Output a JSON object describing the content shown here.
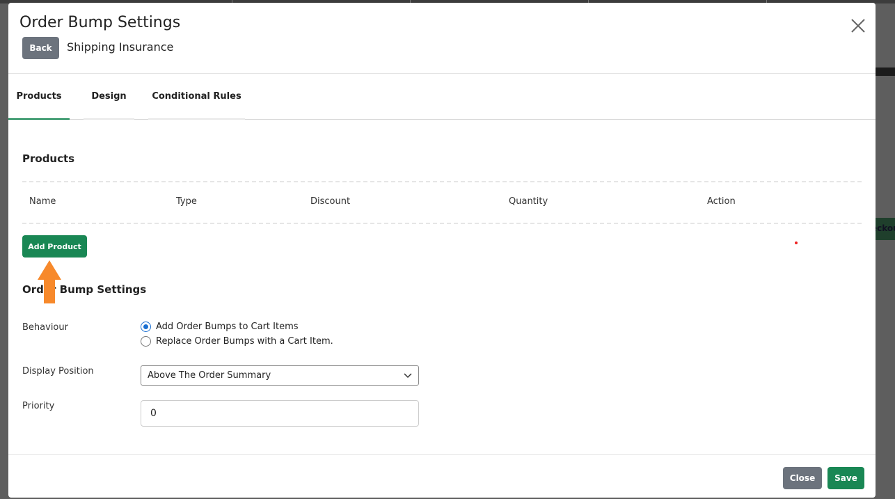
{
  "modal": {
    "title": "Order Bump Settings",
    "back_label": "Back",
    "bump_name": "Shipping Insurance"
  },
  "tabs": [
    {
      "label": "Products",
      "active": true
    },
    {
      "label": "Design",
      "active": false
    },
    {
      "label": "Conditional Rules",
      "active": false
    }
  ],
  "products": {
    "title": "Products",
    "columns": [
      "Name",
      "Type",
      "Discount",
      "Quantity",
      "Action"
    ],
    "rows": [],
    "add_label": "Add Product"
  },
  "settings": {
    "title": "Order Bump Settings",
    "behaviour_label": "Behaviour",
    "behaviour_options": [
      {
        "label": "Add Order Bumps to Cart Items",
        "checked": true
      },
      {
        "label": "Replace Order Bumps with a Cart Item.",
        "checked": false
      }
    ],
    "position_label": "Display Position",
    "position_value": "Above The Order Summary",
    "priority_label": "Priority",
    "priority_value": "0"
  },
  "footer": {
    "close_label": "Close",
    "save_label": "Save"
  },
  "backdrop": {
    "partial_button_text": "eckou"
  },
  "icons": {
    "close": "close-icon",
    "select": "chevron-down-icon",
    "annotation": "arrow-up-icon"
  },
  "colors": {
    "primary_green": "#198754",
    "secondary_gray": "#6c737d",
    "annotation_orange": "#f7892b",
    "radio_blue": "#1a6fd1"
  }
}
